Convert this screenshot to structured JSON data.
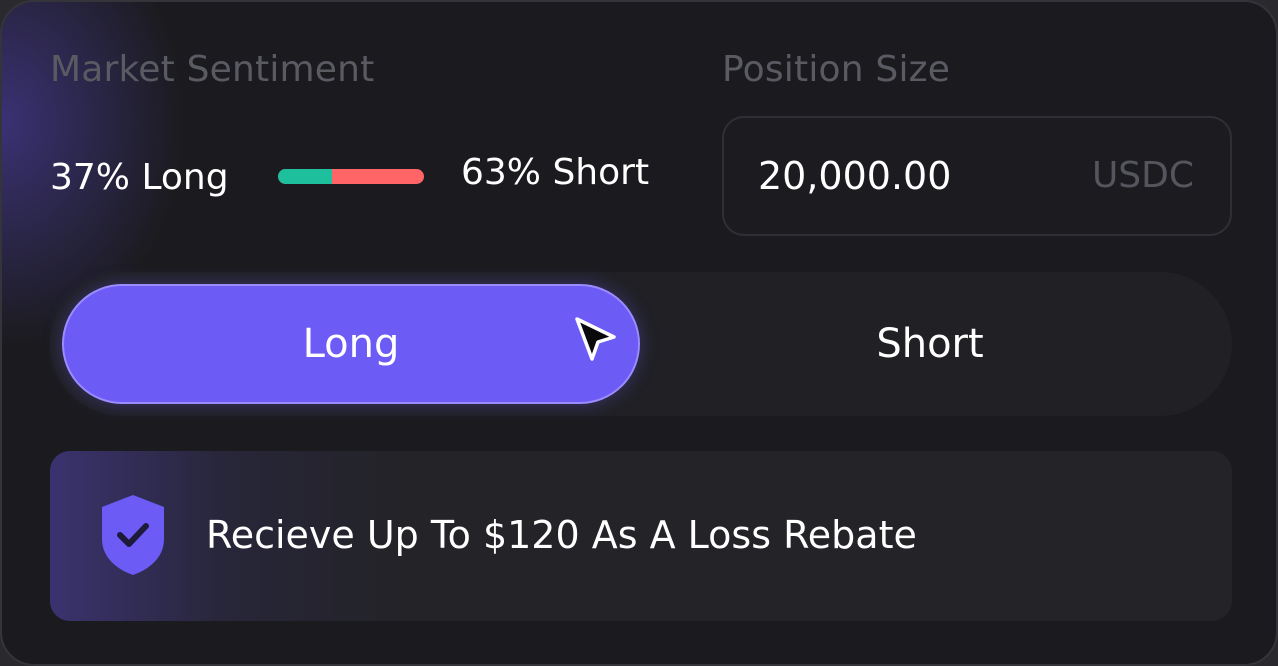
{
  "sentiment": {
    "label": "Market Sentiment",
    "long_text": "37% Long",
    "short_text": "63% Short",
    "long_fraction": 0.37,
    "long_color": "#1dbf9c",
    "short_color": "#ff6466"
  },
  "position": {
    "label": "Position Size",
    "value": "20,000.00",
    "unit": "USDC"
  },
  "direction_toggle": {
    "long_label": "Long",
    "short_label": "Short",
    "selected": "Long",
    "accent_color": "#6c5bf5"
  },
  "rebate": {
    "icon": "shield-check-icon",
    "text": "Recieve Up To $120 As A Loss Rebate"
  },
  "cursor": {
    "icon": "mouse-pointer-icon"
  }
}
